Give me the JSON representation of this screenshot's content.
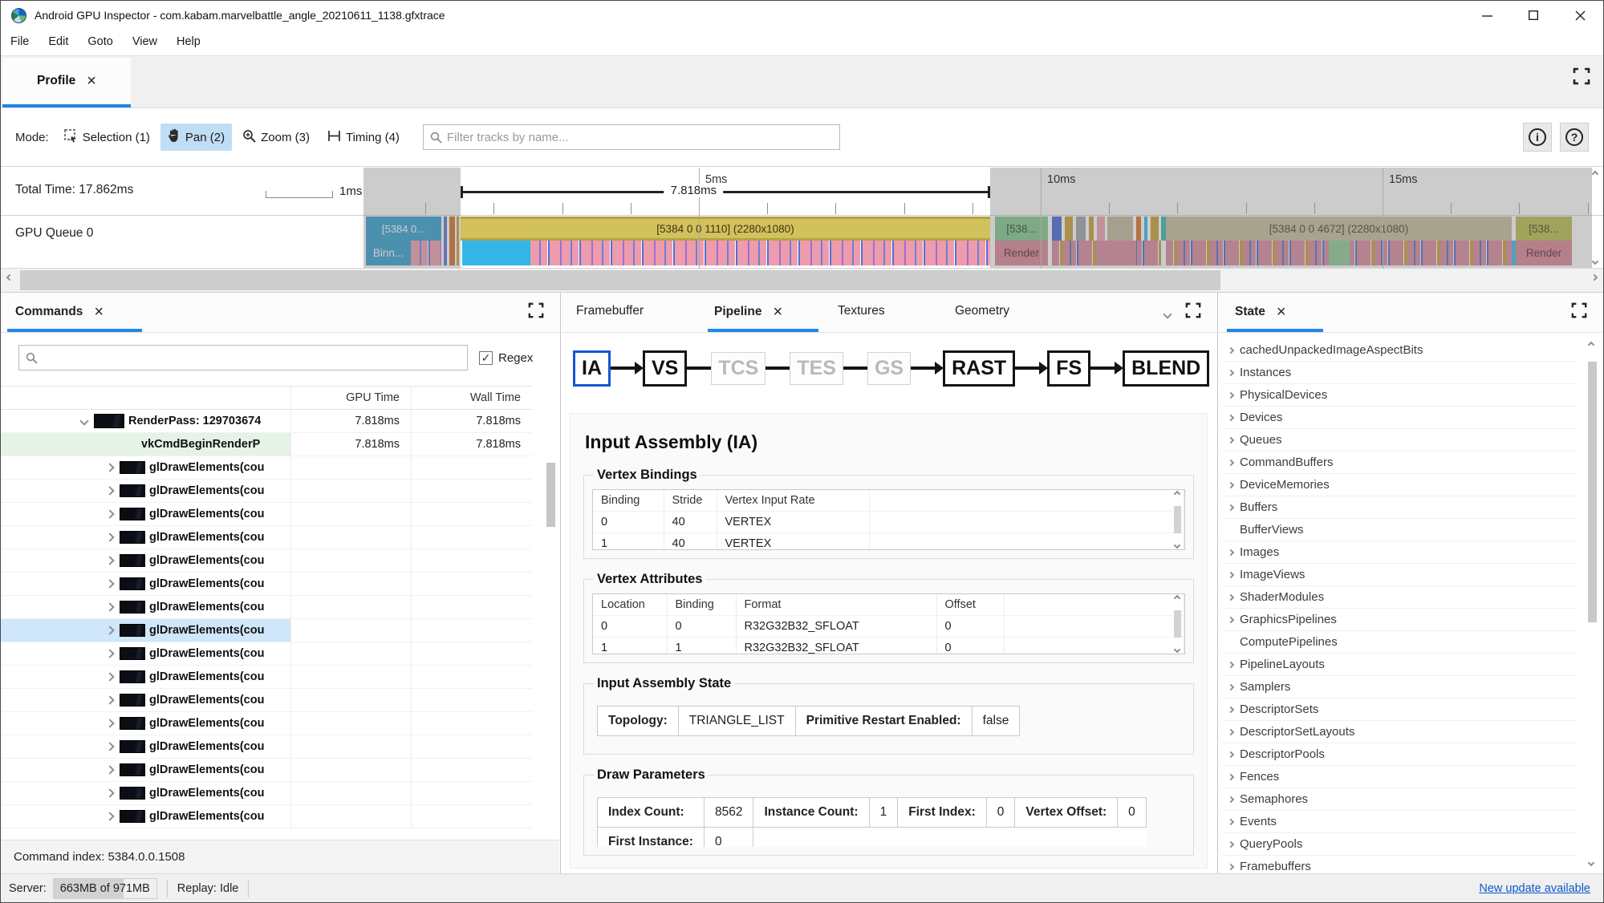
{
  "window": {
    "title": "Android GPU Inspector - com.kabam.marvelbattle_angle_20210611_1138.gfxtrace"
  },
  "menu": {
    "items": [
      "File",
      "Edit",
      "Goto",
      "View",
      "Help"
    ]
  },
  "profile_tab": {
    "label": "Profile"
  },
  "toolbar": {
    "mode_label": "Mode:",
    "modes": [
      {
        "label": "Selection (1)",
        "icon": "selection-icon",
        "active": false
      },
      {
        "label": "Pan (2)",
        "icon": "pan-hand-icon",
        "active": true
      },
      {
        "label": "Zoom (3)",
        "icon": "zoom-magnifier-icon",
        "active": false
      },
      {
        "label": "Timing (4)",
        "icon": "timing-icon",
        "active": false
      }
    ],
    "filter_placeholder": "Filter tracks by name...",
    "info_glyph": "i",
    "help_glyph": "?"
  },
  "timeline": {
    "total_time": "Total Time: 17.862ms",
    "scale_label": "1ms",
    "measurement": "7.818ms",
    "ticks": [
      "5ms",
      "10ms",
      "15ms"
    ],
    "track_label": "GPU Queue 0",
    "spans": {
      "binning_top": "[5384 0...",
      "binning_bottom": "Binn...",
      "pass1": "[5384 0 0 1110] (2280x1080)",
      "pass2_top": "[538...",
      "pass2_bottom": "Render",
      "pass3": "[5384 0 0 4672] (2280x1080)",
      "pass4_top": "[538...",
      "pass4_bottom": "Render"
    }
  },
  "commands": {
    "tab": "Commands",
    "regex_label": "Regex",
    "search_placeholder": "",
    "columns": [
      "GPU Time",
      "Wall Time"
    ],
    "rows": [
      {
        "kind": "pass",
        "label": "RenderPass: 129703674",
        "gpu": "7.818ms",
        "wall": "7.818ms",
        "selected": false
      },
      {
        "kind": "begin",
        "label": "vkCmdBeginRenderP",
        "gpu": "7.818ms",
        "wall": "7.818ms",
        "selected": false
      },
      {
        "kind": "draw",
        "label": "glDrawElements(cou",
        "gpu": "",
        "wall": "",
        "selected": false
      },
      {
        "kind": "draw",
        "label": "glDrawElements(cou",
        "gpu": "",
        "wall": "",
        "selected": false
      },
      {
        "kind": "draw",
        "label": "glDrawElements(cou",
        "gpu": "",
        "wall": "",
        "selected": false
      },
      {
        "kind": "draw",
        "label": "glDrawElements(cou",
        "gpu": "",
        "wall": "",
        "selected": false
      },
      {
        "kind": "draw",
        "label": "glDrawElements(cou",
        "gpu": "",
        "wall": "",
        "selected": false
      },
      {
        "kind": "draw",
        "label": "glDrawElements(cou",
        "gpu": "",
        "wall": "",
        "selected": false
      },
      {
        "kind": "draw",
        "label": "glDrawElements(cou",
        "gpu": "",
        "wall": "",
        "selected": false
      },
      {
        "kind": "draw",
        "label": "glDrawElements(cou",
        "gpu": "",
        "wall": "",
        "selected": true
      },
      {
        "kind": "draw",
        "label": "glDrawElements(cou",
        "gpu": "",
        "wall": "",
        "selected": false
      },
      {
        "kind": "draw",
        "label": "glDrawElements(cou",
        "gpu": "",
        "wall": "",
        "selected": false
      },
      {
        "kind": "draw",
        "label": "glDrawElements(cou",
        "gpu": "",
        "wall": "",
        "selected": false
      },
      {
        "kind": "draw",
        "label": "glDrawElements(cou",
        "gpu": "",
        "wall": "",
        "selected": false
      },
      {
        "kind": "draw",
        "label": "glDrawElements(cou",
        "gpu": "",
        "wall": "",
        "selected": false
      },
      {
        "kind": "draw",
        "label": "glDrawElements(cou",
        "gpu": "",
        "wall": "",
        "selected": false
      },
      {
        "kind": "draw",
        "label": "glDrawElements(cou",
        "gpu": "",
        "wall": "",
        "selected": false
      },
      {
        "kind": "draw",
        "label": "glDrawElements(cou",
        "gpu": "",
        "wall": "",
        "selected": false
      }
    ],
    "footer": "Command index: 5384.0.0.1508"
  },
  "pipeline_panel": {
    "tabs": [
      {
        "label": "Framebuffer",
        "active": false
      },
      {
        "label": "Pipeline",
        "active": true
      },
      {
        "label": "Textures",
        "active": false
      },
      {
        "label": "Geometry",
        "active": false
      }
    ],
    "stages": [
      {
        "label": "IA",
        "state": "selected"
      },
      {
        "label": "VS",
        "state": "active"
      },
      {
        "label": "TCS",
        "state": "disabled"
      },
      {
        "label": "TES",
        "state": "disabled"
      },
      {
        "label": "GS",
        "state": "disabled"
      },
      {
        "label": "RAST",
        "state": "active"
      },
      {
        "label": "FS",
        "state": "active"
      },
      {
        "label": "BLEND",
        "state": "active"
      }
    ],
    "section_title": "Input Assembly (IA)",
    "vertex_bindings": {
      "title": "Vertex Bindings",
      "columns": [
        "Binding",
        "Stride",
        "Vertex Input Rate"
      ],
      "rows": [
        [
          "0",
          "40",
          "VERTEX"
        ],
        [
          "1",
          "40",
          "VERTEX"
        ]
      ]
    },
    "vertex_attributes": {
      "title": "Vertex Attributes",
      "columns": [
        "Location",
        "Binding",
        "Format",
        "Offset"
      ],
      "rows": [
        [
          "0",
          "0",
          "R32G32B32_SFLOAT",
          "0"
        ],
        [
          "1",
          "1",
          "R32G32B32_SFLOAT",
          "0"
        ]
      ]
    },
    "input_assembly_state": {
      "title": "Input Assembly State",
      "fields": [
        {
          "k": "Topology:",
          "v": "TRIANGLE_LIST"
        },
        {
          "k": "Primitive Restart Enabled:",
          "v": "false"
        }
      ]
    },
    "draw_parameters": {
      "title": "Draw Parameters",
      "fields": [
        {
          "k": "Index Count:",
          "v": "8562"
        },
        {
          "k": "Instance Count:",
          "v": "1"
        },
        {
          "k": "First Index:",
          "v": "0"
        },
        {
          "k": "Vertex Offset:",
          "v": "0"
        }
      ],
      "clipped_fields": [
        {
          "k": "First Instance:",
          "v": "0"
        }
      ]
    }
  },
  "state_panel": {
    "tab": "State",
    "items": [
      {
        "label": "cachedUnpackedImageAspectBits",
        "expandable": true
      },
      {
        "label": "Instances",
        "expandable": true
      },
      {
        "label": "PhysicalDevices",
        "expandable": true
      },
      {
        "label": "Devices",
        "expandable": true
      },
      {
        "label": "Queues",
        "expandable": true
      },
      {
        "label": "CommandBuffers",
        "expandable": true
      },
      {
        "label": "DeviceMemories",
        "expandable": true
      },
      {
        "label": "Buffers",
        "expandable": true
      },
      {
        "label": "BufferViews",
        "expandable": false
      },
      {
        "label": "Images",
        "expandable": true
      },
      {
        "label": "ImageViews",
        "expandable": true
      },
      {
        "label": "ShaderModules",
        "expandable": true
      },
      {
        "label": "GraphicsPipelines",
        "expandable": true
      },
      {
        "label": "ComputePipelines",
        "expandable": false
      },
      {
        "label": "PipelineLayouts",
        "expandable": true
      },
      {
        "label": "Samplers",
        "expandable": true
      },
      {
        "label": "DescriptorSets",
        "expandable": true
      },
      {
        "label": "DescriptorSetLayouts",
        "expandable": true
      },
      {
        "label": "DescriptorPools",
        "expandable": true
      },
      {
        "label": "Fences",
        "expandable": true
      },
      {
        "label": "Semaphores",
        "expandable": true
      },
      {
        "label": "Events",
        "expandable": true
      },
      {
        "label": "QueryPools",
        "expandable": true
      },
      {
        "label": "Framebuffers",
        "expandable": true
      }
    ]
  },
  "statusbar": {
    "server_label": "Server:",
    "server_value": "663MB of 971MB",
    "replay": "Replay: Idle",
    "update_link": "New update available"
  },
  "colors": {
    "accent_blue": "#1e88e5",
    "pan_highlight": "#bfddf5",
    "pass_khaki": "#d2c15c",
    "pass_tan": "#c5b998",
    "pass_green": "#7cc687",
    "pass_olive": "#b7b945",
    "binning_blue": "#2b9bd0",
    "draw_pink": "#ee9bad",
    "render_pink": "#d97f93",
    "cyan": "#33b5e8"
  }
}
